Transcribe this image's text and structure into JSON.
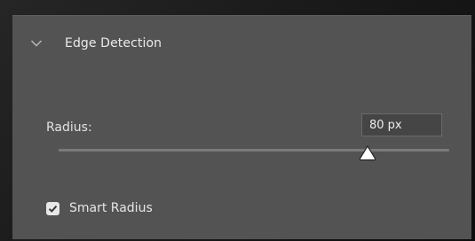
{
  "section": {
    "title": "Edge Detection",
    "expanded": true
  },
  "radius": {
    "label": "Radius:",
    "value": "80 px",
    "slider_fraction": 0.79
  },
  "smart_radius": {
    "label": "Smart Radius",
    "checked": true
  },
  "icons": {
    "collapse": "chevron-down-icon",
    "check": "checkmark-icon",
    "thumb": "triangle-thumb-icon"
  },
  "colors": {
    "panel": "#535353",
    "field": "#454545",
    "track": "#7a7a7a",
    "thumb": "#ffffff",
    "text": "#e6e6e6"
  }
}
